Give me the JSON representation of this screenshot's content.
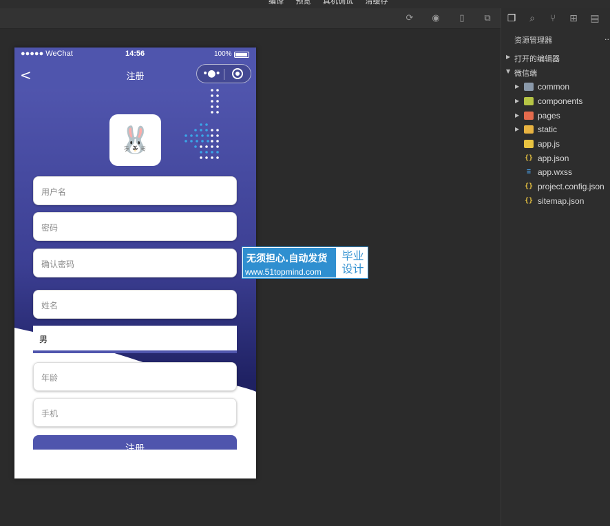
{
  "menu": {
    "items": [
      "编译",
      "预览",
      "真机调试",
      "清缓存"
    ]
  },
  "toolbar": {
    "icons": [
      "refresh-icon",
      "stop-icon",
      "phone-icon",
      "window-icon"
    ]
  },
  "simulator": {
    "status": {
      "carrier": "●●●●● WeChat",
      "time": "14:56",
      "battery": "100%"
    },
    "nav": {
      "back": "<",
      "title": "注册"
    },
    "logo_emoji": "🐰",
    "fields": {
      "username": "用户名",
      "password": "密码",
      "confirm_password": "确认密码",
      "name": "姓名",
      "gender_value": "男",
      "age": "年龄",
      "phone": "手机"
    },
    "submit": "注册"
  },
  "watermark": {
    "line1": "无须担心.自动发货",
    "line2": "www.51topmind.com",
    "right1": "毕业",
    "right2": "设计"
  },
  "explorer": {
    "title": "资源管理器",
    "title_more": "...",
    "sections": {
      "open_editors": "打开的编辑器",
      "project": "微信端"
    },
    "items": [
      {
        "name": "common",
        "type": "folder",
        "color": "#8a99aa"
      },
      {
        "name": "components",
        "type": "folder",
        "color": "#b6c545"
      },
      {
        "name": "pages",
        "type": "folder",
        "color": "#e46b4d"
      },
      {
        "name": "static",
        "type": "folder",
        "color": "#e8b341"
      },
      {
        "name": "app.js",
        "type": "js",
        "color": "#e8c341"
      },
      {
        "name": "app.json",
        "type": "json",
        "color": "#e8c341"
      },
      {
        "name": "app.wxss",
        "type": "wxss",
        "color": "#4aa0e6"
      },
      {
        "name": "project.config.json",
        "type": "json",
        "color": "#e8c341"
      },
      {
        "name": "sitemap.json",
        "type": "json",
        "color": "#e8c341"
      }
    ]
  }
}
